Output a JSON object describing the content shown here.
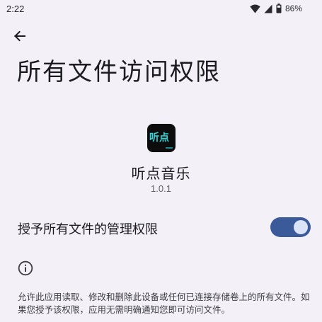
{
  "status_bar": {
    "time": "2:22",
    "battery": "86%",
    "icons": [
      "wifi-icon",
      "signal-icon",
      "battery-icon"
    ]
  },
  "toolbar": {
    "back_icon": "arrow-left-icon"
  },
  "page": {
    "title": "所有文件访问权限"
  },
  "app": {
    "icon_label": "听点",
    "name": "听点音乐",
    "version": "1.0.1"
  },
  "permission": {
    "label": "授予所有文件的管理权限",
    "enabled": true,
    "toggle_color": "#3a5a9a"
  },
  "info": {
    "icon": "info-icon",
    "text": "允许此应用读取、修改和删除此设备或任何已连接存储卷上的所有文件。如果您授予该权限，应用无需明确通知您即可访问文件。"
  }
}
